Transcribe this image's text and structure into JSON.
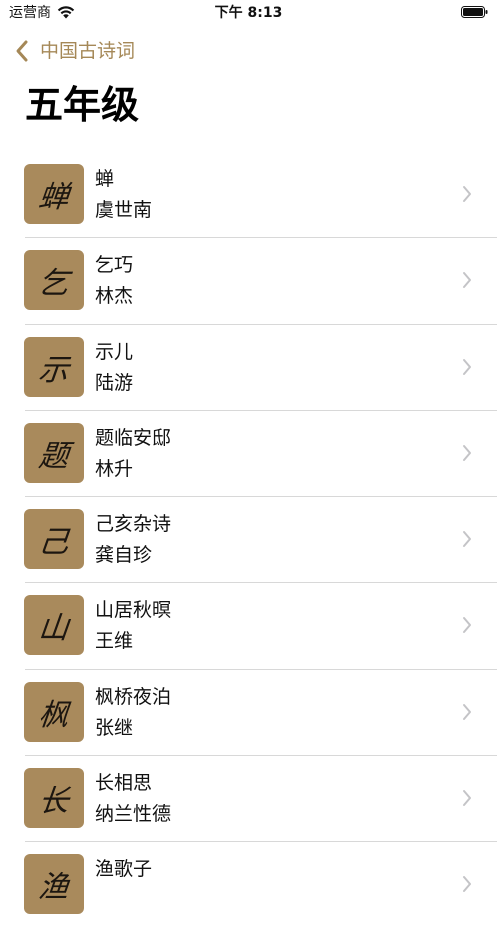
{
  "status_bar": {
    "carrier": "运营商",
    "time": "下午 8:13"
  },
  "nav": {
    "back_label": "中国古诗词"
  },
  "page": {
    "title": "五年级"
  },
  "poems": [
    {
      "title": "蝉",
      "author": "虞世南",
      "glyph": "蝉"
    },
    {
      "title": "乞巧",
      "author": "林杰",
      "glyph": "乞"
    },
    {
      "title": "示儿",
      "author": "陆游",
      "glyph": "示"
    },
    {
      "title": "题临安邸",
      "author": "林升",
      "glyph": "题"
    },
    {
      "title": "己亥杂诗",
      "author": "龚自珍",
      "glyph": "己"
    },
    {
      "title": "山居秋暝",
      "author": "王维",
      "glyph": "山"
    },
    {
      "title": "枫桥夜泊",
      "author": "张继",
      "glyph": "枫"
    },
    {
      "title": "长相思",
      "author": "纳兰性德",
      "glyph": "长"
    },
    {
      "title": "渔歌子",
      "author": "",
      "glyph": "渔"
    }
  ],
  "colors": {
    "accent": "#a58857",
    "thumb_bg": "#a98a5c",
    "separator": "#d8d8d8",
    "chevron": "#c4c4c7"
  }
}
